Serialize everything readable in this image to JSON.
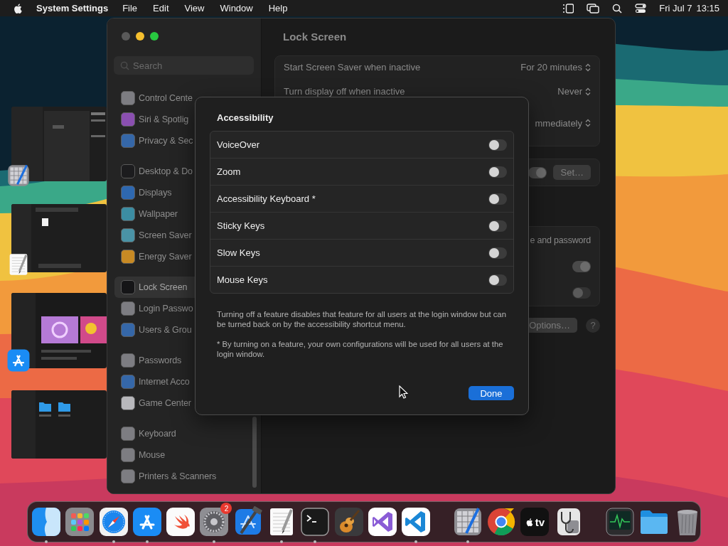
{
  "menu_bar": {
    "app_name": "System Settings",
    "menus": [
      "File",
      "Edit",
      "View",
      "Window",
      "Help"
    ],
    "date": "Fri Jul 7",
    "time": "13:15"
  },
  "stage_manager": [
    {
      "kind": "sketch"
    },
    {
      "kind": "textedit"
    },
    {
      "kind": "appstore"
    },
    {
      "kind": "finder"
    }
  ],
  "window": {
    "sidebar": {
      "search": {
        "placeholder": "Search"
      },
      "groups": [
        [
          {
            "label": "Control Cente",
            "color": "#7d7d82",
            "selected": false
          },
          {
            "label": "Siri & Spotlig",
            "color": "#8a4fb0",
            "selected": false
          },
          {
            "label": "Privacy & Sec",
            "color": "#3567a8",
            "selected": false
          }
        ],
        [
          {
            "label": "Desktop & Do",
            "color": "#1c1c1e",
            "selected": false
          },
          {
            "label": "Displays",
            "color": "#2e68b0",
            "selected": false
          },
          {
            "label": "Wallpaper",
            "color": "#3c8da3",
            "selected": false
          },
          {
            "label": "Screen Saver",
            "color": "#4a93a6",
            "selected": false
          },
          {
            "label": "Energy Saver",
            "color": "#c88a24",
            "selected": false
          }
        ],
        [
          {
            "label": "Lock Screen",
            "color": "#151517",
            "selected": true
          },
          {
            "label": "Login Passwo",
            "color": "#7d7d82",
            "selected": false
          },
          {
            "label": "Users & Grou",
            "color": "#3567a8",
            "selected": false
          }
        ],
        [
          {
            "label": "Passwords",
            "color": "#7d7d82",
            "selected": false
          },
          {
            "label": "Internet Acco",
            "color": "#3567a8",
            "selected": false
          },
          {
            "label": "Game Center",
            "color": "#b8b8bc",
            "selected": false
          }
        ],
        [
          {
            "label": "Keyboard",
            "color": "#7d7d82",
            "selected": false
          },
          {
            "label": "Mouse",
            "color": "#7d7d82",
            "selected": false
          },
          {
            "label": "Printers & Scanners",
            "color": "#7d7d82",
            "selected": false
          }
        ]
      ]
    },
    "content": {
      "title": "Lock Screen",
      "groups": [
        {
          "rows": [
            {
              "kind": "popup",
              "label": "Start Screen Saver when inactive",
              "value": "For 20 minutes"
            },
            {
              "kind": "popup",
              "label": "Turn display off when inactive",
              "value": "Never"
            },
            {
              "kind": "popup",
              "value": "mmediately"
            }
          ]
        },
        {
          "rows": [
            {
              "kind": "toggle_button",
              "on": true,
              "button": "Set…"
            }
          ]
        },
        {
          "rows": [
            {
              "kind": "text",
              "label": "e and password"
            },
            {
              "kind": "toggle",
              "on": true
            },
            {
              "kind": "toggle",
              "on": false
            }
          ]
        }
      ],
      "options_button": "Options…",
      "help_button": "?"
    }
  },
  "dialog": {
    "title": "Accessibility",
    "features": [
      {
        "label": "VoiceOver",
        "on": false
      },
      {
        "label": "Zoom",
        "on": false
      },
      {
        "label": "Accessibility Keyboard *",
        "on": false
      },
      {
        "label": "Sticky Keys",
        "on": false
      },
      {
        "label": "Slow Keys",
        "on": false
      },
      {
        "label": "Mouse Keys",
        "on": false
      }
    ],
    "notes": [
      "Turning off a feature disables that feature for all users at the login window but can be turned back on by the accessibility shortcut menu.",
      "* By turning on a feature, your own configurations will be used for all users at the login window."
    ],
    "done_button": "Done"
  },
  "dock": {
    "items": [
      {
        "kind": "finder",
        "running": true
      },
      {
        "kind": "launchpad",
        "running": false
      },
      {
        "kind": "safari",
        "running": true
      },
      {
        "kind": "appstore",
        "running": true
      },
      {
        "kind": "swift",
        "running": false
      },
      {
        "kind": "settings",
        "running": true,
        "badge": "2"
      },
      {
        "kind": "xcode",
        "running": false
      },
      {
        "kind": "textedit",
        "running": true
      },
      {
        "kind": "terminal",
        "running": true
      },
      {
        "kind": "garageband",
        "running": false
      },
      {
        "kind": "visualstudio",
        "running": false
      },
      {
        "kind": "vscode",
        "running": true
      },
      {
        "kind": "separator"
      },
      {
        "kind": "sketch",
        "running": true
      },
      {
        "kind": "chrome",
        "running": false
      },
      {
        "kind": "tv",
        "label": "tv",
        "running": false
      },
      {
        "kind": "diskutility",
        "running": false
      },
      {
        "kind": "separator"
      },
      {
        "kind": "activity",
        "running": false
      },
      {
        "kind": "folder",
        "running": false
      },
      {
        "kind": "trash",
        "running": false
      }
    ]
  }
}
